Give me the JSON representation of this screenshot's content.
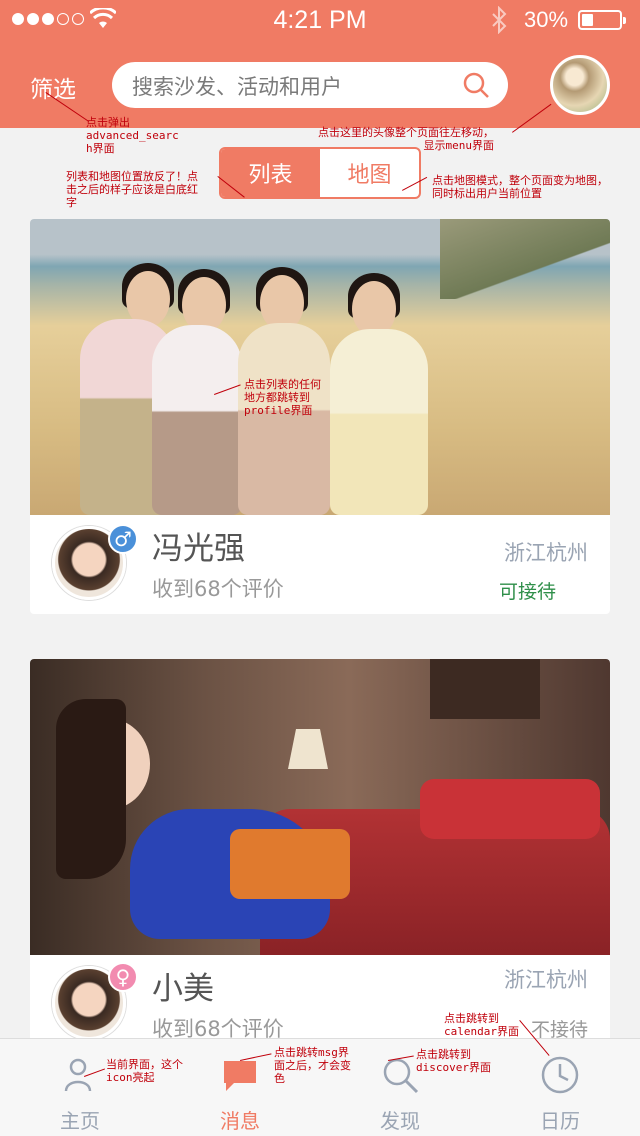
{
  "status_bar": {
    "time": "4:21 PM",
    "battery": "30%",
    "battery_level": 0.3
  },
  "header": {
    "filter_label": "筛选",
    "search_placeholder": "搜索沙发、活动和用户"
  },
  "view_toggle": {
    "list_label": "列表",
    "map_label": "地图",
    "active": "列表"
  },
  "listings": [
    {
      "name": "冯光强",
      "gender": "♂",
      "reviews": "收到68个评价",
      "city": "浙江杭州",
      "status": "可接待"
    },
    {
      "name": "小美",
      "gender": "♀",
      "reviews": "收到68个评价",
      "city": "浙江杭州",
      "status": "不接待"
    }
  ],
  "tabbar": {
    "tabs": [
      {
        "label": "主页",
        "icon": "home-icon"
      },
      {
        "label": "消息",
        "icon": "message-icon"
      },
      {
        "label": "发现",
        "icon": "discover-search-icon"
      },
      {
        "label": "日历",
        "icon": "calendar-clock-icon"
      }
    ],
    "active": "消息"
  },
  "annotations": {
    "filter": "点击弹出\nadvanced_searc\nh界面",
    "avatar": "点击这里的头像整个页面往左移动，\n显示menu界面",
    "toggle": "列表和地图位置放反了！点\n击之后的样子应该是白底红\n字",
    "map": "点击地图模式，整个页面变为地图，\n同时标出用户当前位置",
    "card": "点击列表的任何\n地方都跳转到\nprofile界面",
    "home": "当前界面，这个\nicon亮起",
    "msg": "点击跳转msg界\n面之后，才会变\n色",
    "discover": "点击跳转到\ndiscover界面",
    "calendar": "点击跳转到\ncalendar界面"
  },
  "colors": {
    "accent": "#f07b64",
    "available": "#2f8f4a",
    "annotation": "#c0000b"
  }
}
